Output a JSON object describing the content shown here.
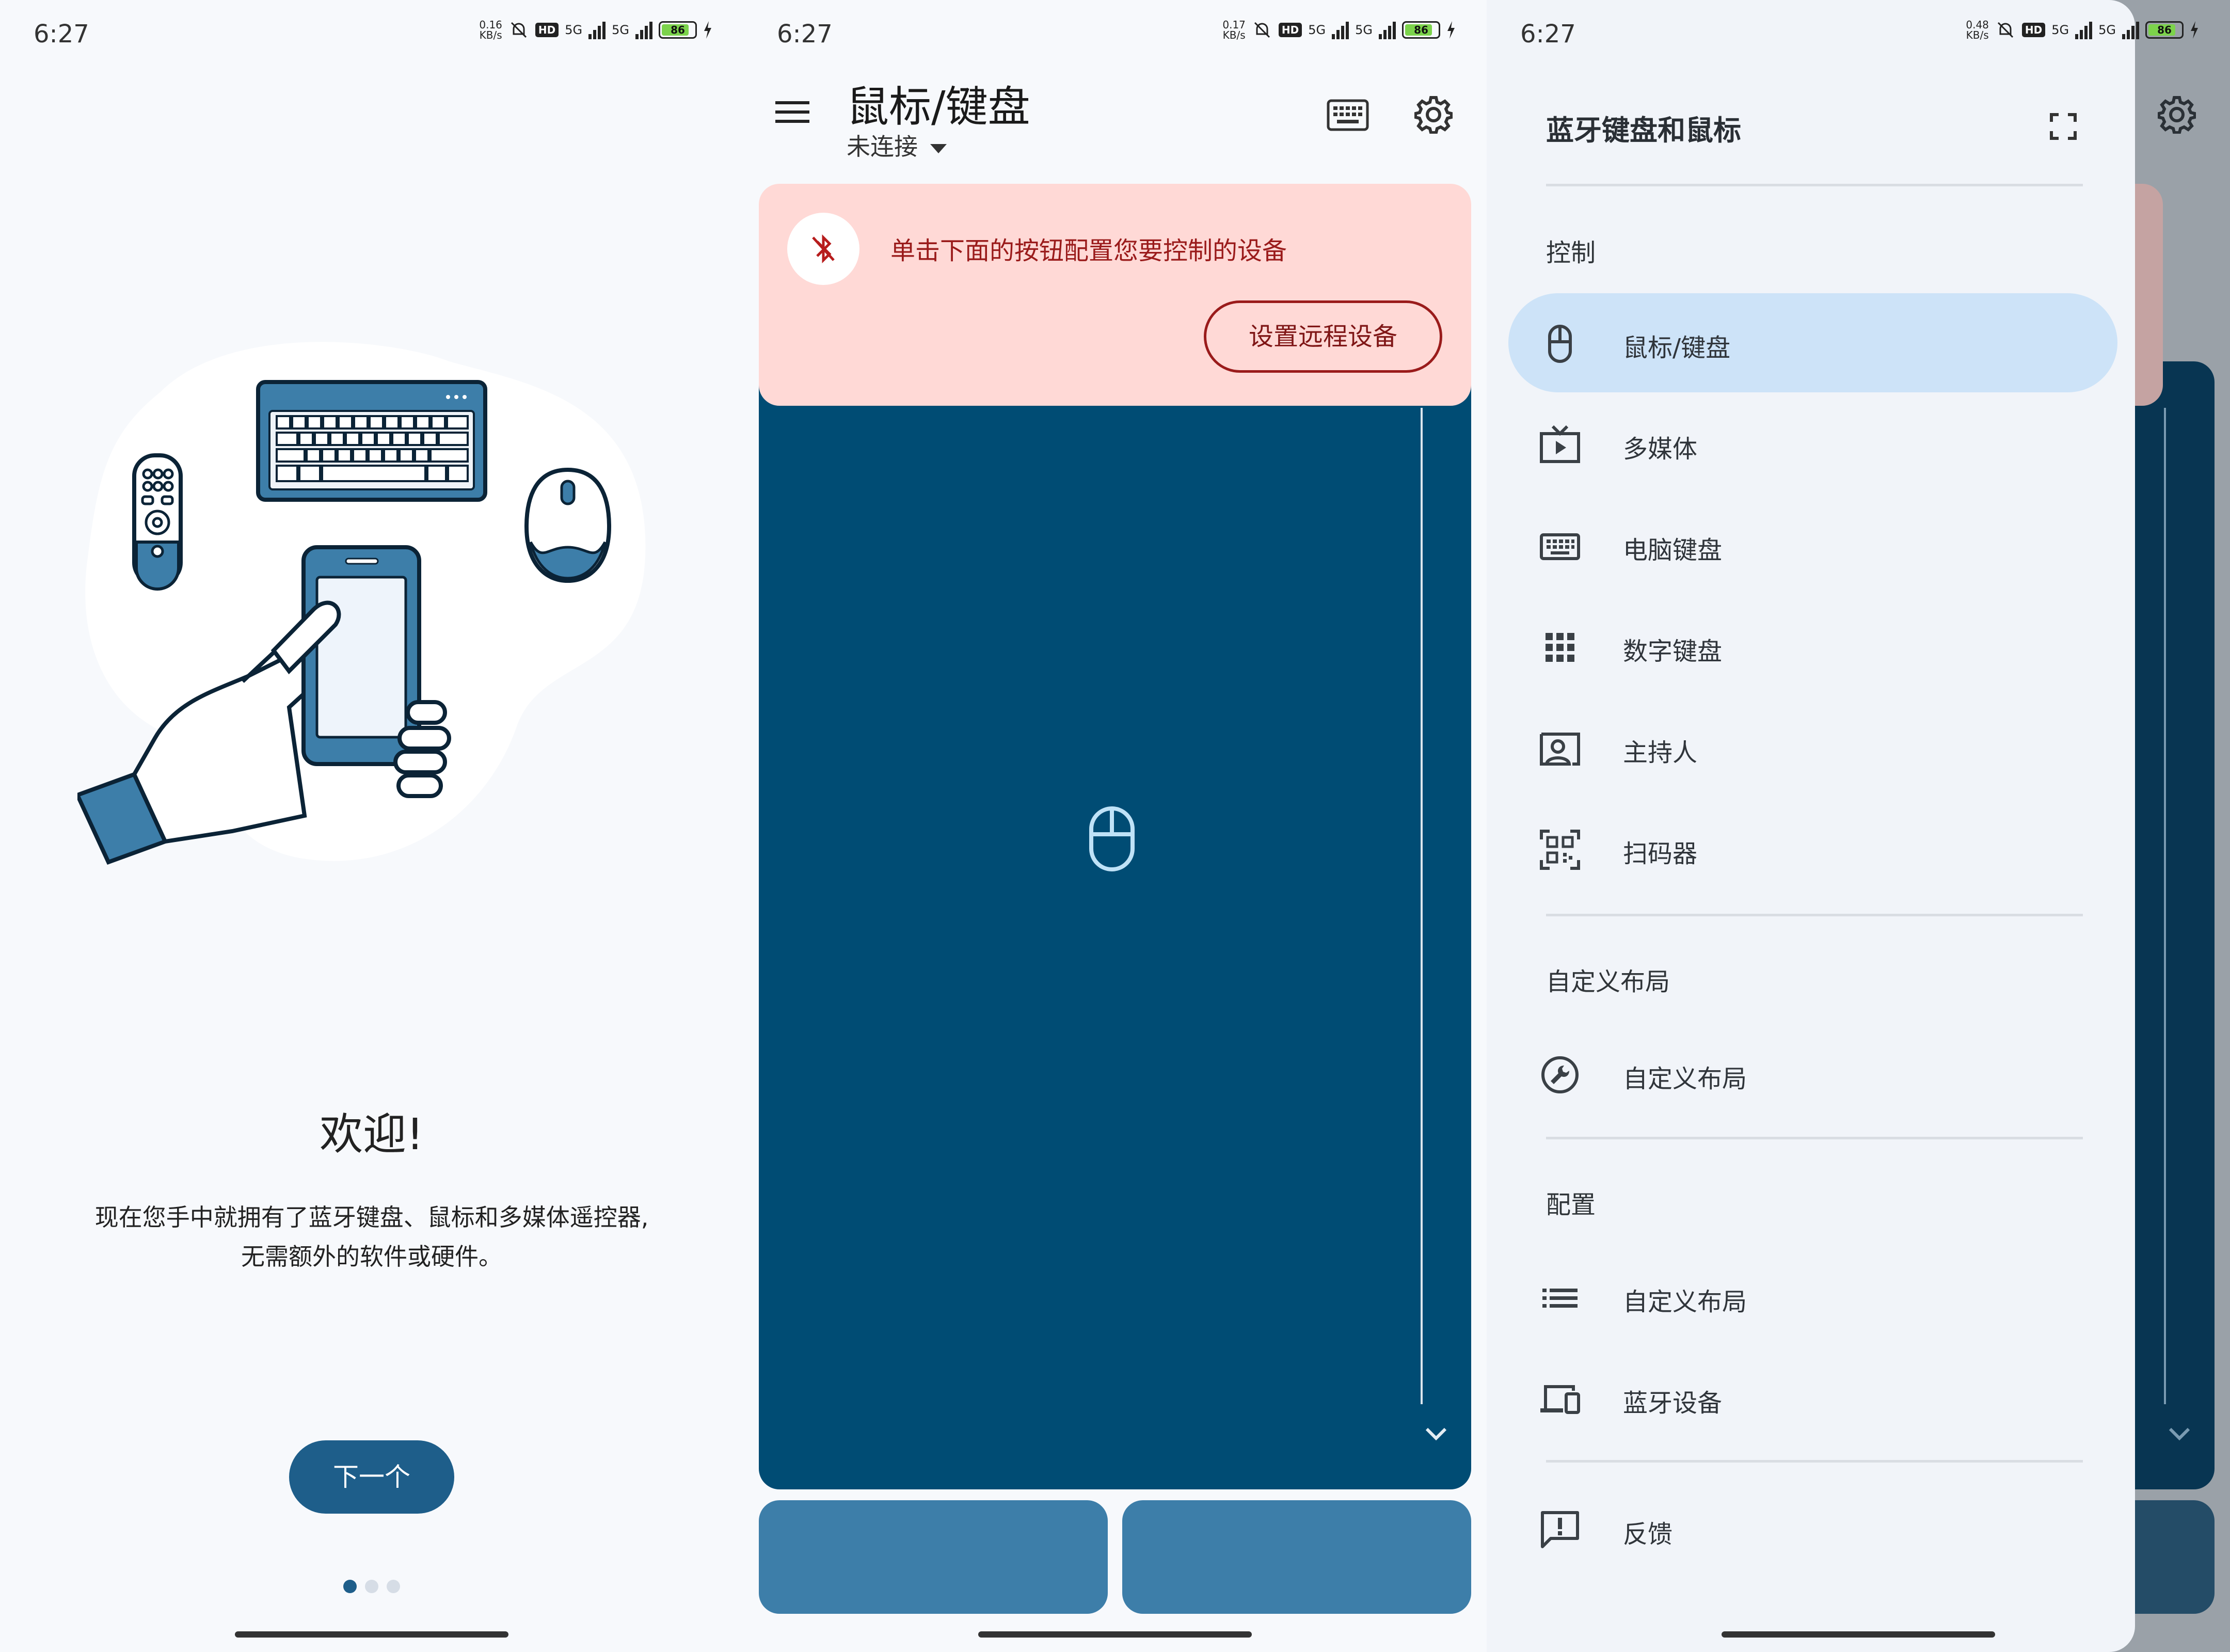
{
  "status_bars": [
    {
      "time": "6:27",
      "speed_value": "0.16",
      "speed_unit": "KB/s",
      "hd": "HD",
      "net1": "5G",
      "net2": "5G",
      "battery": "86"
    },
    {
      "time": "6:27",
      "speed_value": "0.17",
      "speed_unit": "KB/s",
      "hd": "HD",
      "net1": "5G",
      "net2": "5G",
      "battery": "86"
    },
    {
      "time": "6:27",
      "speed_value": "0.48",
      "speed_unit": "KB/s",
      "hd": "HD",
      "net1": "5G",
      "net2": "5G",
      "battery": "86"
    }
  ],
  "onboarding": {
    "title": "欢迎!",
    "text_line1": "现在您手中就拥有了蓝牙键盘、鼠标和多媒体遥控器,",
    "text_line2": "无需额外的软件或硬件。",
    "next_label": "下一个",
    "page_count": 3,
    "current_page": 1
  },
  "main": {
    "title": "鼠标/键盘",
    "subtitle": "未连接",
    "banner_text": "单击下面的按钮配置您要控制的设备",
    "setup_label": "设置远程设备"
  },
  "drawer": {
    "title": "蓝牙键盘和鼠标",
    "sections": [
      {
        "label": "控制"
      },
      {
        "label": "自定义布局"
      },
      {
        "label": "配置"
      }
    ],
    "items": [
      {
        "label": "鼠标/键盘",
        "icon": "mouse-icon",
        "active": true
      },
      {
        "label": "多媒体",
        "icon": "tv-play-icon"
      },
      {
        "label": "电脑键盘",
        "icon": "keyboard-icon"
      },
      {
        "label": "数字键盘",
        "icon": "numpad-icon"
      },
      {
        "label": "主持人",
        "icon": "presenter-icon"
      },
      {
        "label": "扫码器",
        "icon": "qr-scan-icon"
      },
      {
        "label": "自定义布局",
        "icon": "wrench-icon"
      },
      {
        "label": "自定义布局",
        "icon": "list-icon"
      },
      {
        "label": "蓝牙设备",
        "icon": "devices-icon"
      },
      {
        "label": "反馈",
        "icon": "feedback-icon"
      }
    ]
  },
  "colors": {
    "primary": "#1e5e8a",
    "touchpad": "#004c74",
    "button": "#3d7ea9",
    "banner": "#ffd9d6",
    "banner_text": "#9a1b1b",
    "drawer_active": "#cde3f8"
  }
}
